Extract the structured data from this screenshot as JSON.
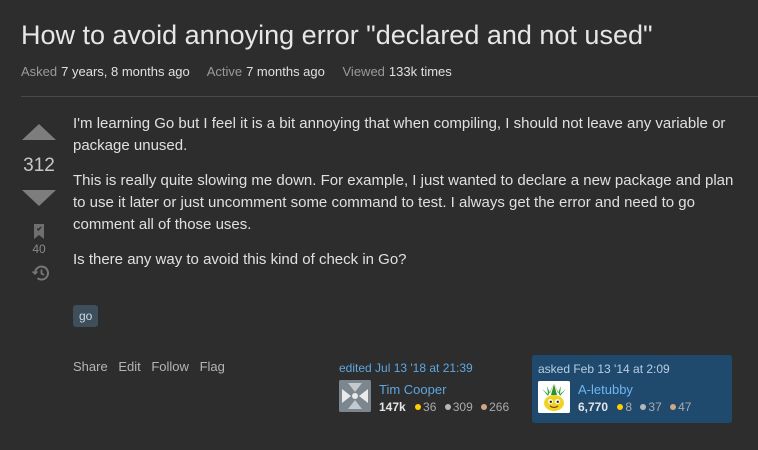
{
  "question": {
    "title": "How to avoid annoying error \"declared and not used\"",
    "meta": {
      "asked_label": "Asked",
      "asked_value": "7 years, 8 months ago",
      "active_label": "Active",
      "active_value": "7 months ago",
      "viewed_label": "Viewed",
      "viewed_value": "133k times"
    },
    "votes": "312",
    "bookmarks": "40",
    "body": [
      "I'm learning Go but I feel it is a bit annoying that when compiling, I should not leave any variable or package unused.",
      "This is really quite slowing me down. For example, I just wanted to declare a new package and plan to use it later or just uncomment some command to test. I always get the error and need to go comment all of those uses.",
      "Is there any way to avoid this kind of check in Go?"
    ],
    "tags": [
      "go"
    ],
    "actions": {
      "share": "Share",
      "edit": "Edit",
      "follow": "Follow",
      "flag": "Flag"
    }
  },
  "editor": {
    "time": "edited Jul 13 '18 at 21:39",
    "name": "Tim Cooper",
    "reputation": "147k",
    "gold": "36",
    "silver": "309",
    "bronze": "266"
  },
  "asker": {
    "time": "asked Feb 13 '14 at 2:09",
    "name": "A-letubby",
    "reputation": "6,770",
    "gold": "8",
    "silver": "37",
    "bronze": "47"
  },
  "icons": {
    "upvote": "upvote-arrow-icon",
    "downvote": "downvote-arrow-icon",
    "bookmark": "bookmark-icon",
    "history": "history-icon"
  },
  "colors": {
    "background": "#2d2d2d",
    "link": "#5ea6e0",
    "asker_card": "#1f4a6e",
    "gold": "#ffcc01",
    "silver": "#b4b8bc",
    "bronze": "#d1a684"
  }
}
